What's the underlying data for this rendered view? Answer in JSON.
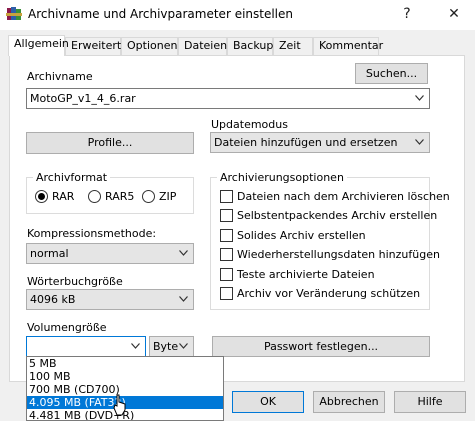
{
  "window": {
    "title": "Archivname und Archivparameter einstellen",
    "help_glyph": "?",
    "close_glyph": "✕",
    "icon": "winrar-books-icon"
  },
  "tabs": [
    {
      "label": "Allgemein",
      "active": true
    },
    {
      "label": "Erweitert",
      "active": false
    },
    {
      "label": "Optionen",
      "active": false
    },
    {
      "label": "Dateien",
      "active": false
    },
    {
      "label": "Backup",
      "active": false
    },
    {
      "label": "Zeit",
      "active": false
    },
    {
      "label": "Kommentar",
      "active": false
    }
  ],
  "general": {
    "archive_name_label": "Archivname",
    "search_button": "Suchen...",
    "archive_name_value": "MotoGP_v1_4_6.rar",
    "profile_button": "Profile...",
    "update_mode_label": "Updatemodus",
    "update_mode_value": "Dateien hinzufügen und ersetzen",
    "archive_format_label": "Archivformat",
    "formats": [
      {
        "label": "RAR",
        "selected": true
      },
      {
        "label": "RAR5",
        "selected": false
      },
      {
        "label": "ZIP",
        "selected": false
      }
    ],
    "compression_label": "Kompressionsmethode:",
    "compression_value": "normal",
    "dictionary_label": "Wörterbuchgröße",
    "dictionary_value": "4096 kB",
    "volume_label": "Volumengröße",
    "volume_value": "",
    "volume_unit": "Byte",
    "password_button": "Passwort festlegen...",
    "options_label": "Archivierungsoptionen",
    "options": [
      {
        "label": "Dateien nach dem Archivieren löschen",
        "checked": false
      },
      {
        "label": "Selbstentpackendes Archiv erstellen",
        "checked": false
      },
      {
        "label": "Solides Archiv erstellen",
        "checked": false
      },
      {
        "label": "Wiederherstellungsdaten hinzufügen",
        "checked": false
      },
      {
        "label": "Teste archivierte Dateien",
        "checked": false
      },
      {
        "label": "Archiv vor Veränderung schützen",
        "checked": false
      }
    ]
  },
  "volume_dropdown": [
    {
      "label": "5 MB",
      "selected": false
    },
    {
      "label": "100 MB",
      "selected": false
    },
    {
      "label": "700 MB  (CD700)",
      "selected": false
    },
    {
      "label": "4.095 MB  (FAT32)",
      "selected": true
    },
    {
      "label": "4.481 MB  (DVD+R)",
      "selected": false
    }
  ],
  "footer": {
    "ok_button": "OK",
    "cancel_button": "Abbrechen",
    "help_button": "Hilfe"
  },
  "colors": {
    "accent": "#0078d7",
    "dialog_bg": "#f0f0f0",
    "panel_bg": "#ffffff"
  }
}
